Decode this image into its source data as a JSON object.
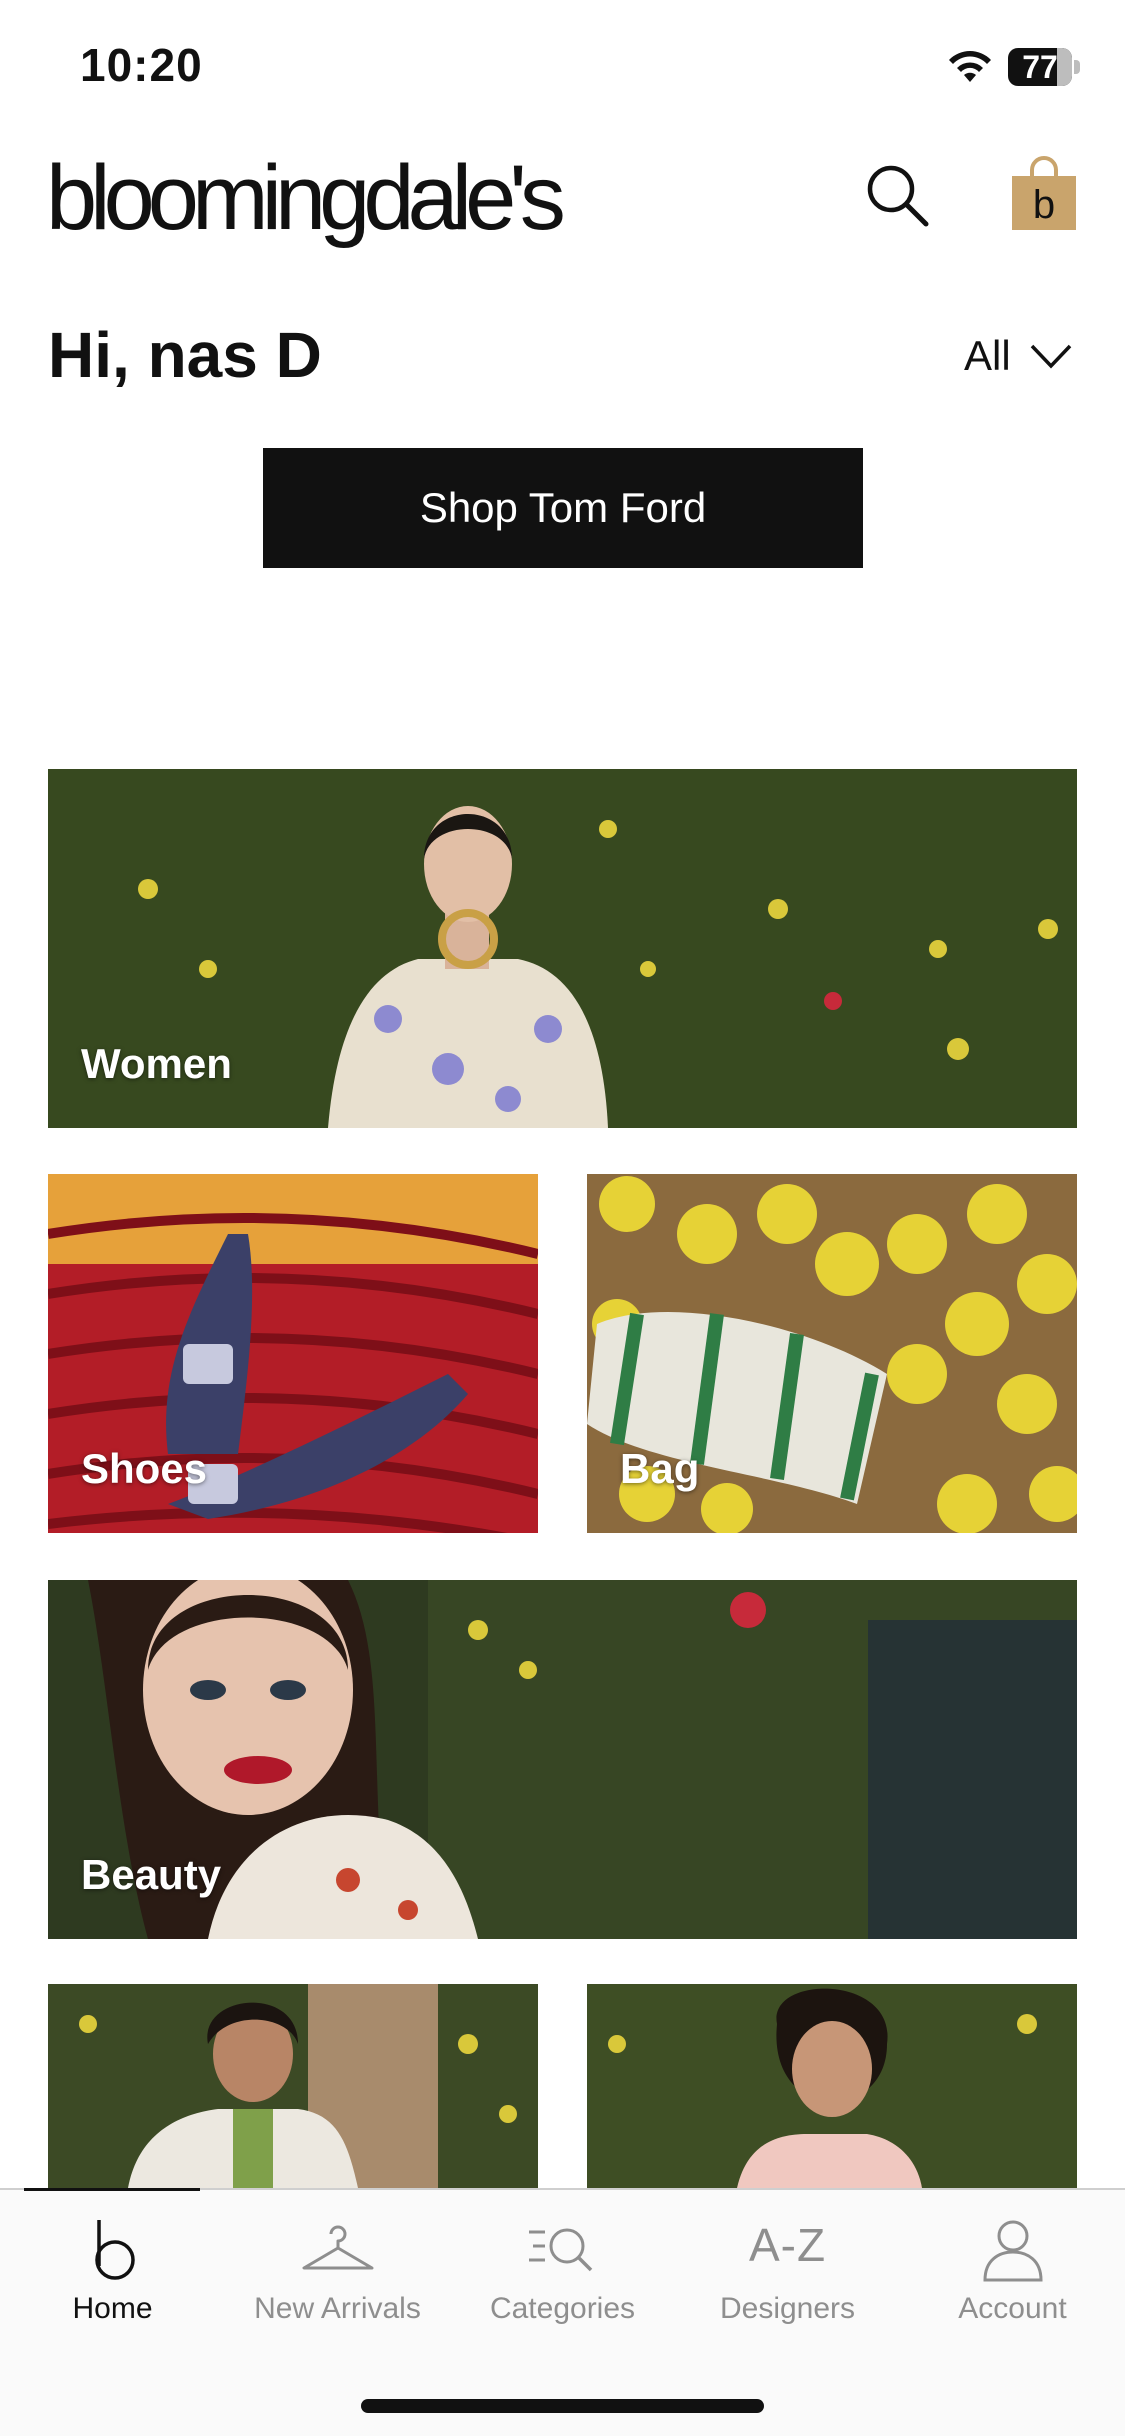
{
  "status_bar": {
    "time": "10:20",
    "battery_percent": "77"
  },
  "header": {
    "logo_text": "bloomingdale's",
    "bag_letter": "b"
  },
  "greeting": "Hi, nas D",
  "filter": {
    "label": "All"
  },
  "cta": {
    "label": "Shop Tom Ford"
  },
  "tiles": [
    {
      "label": "Women"
    },
    {
      "label": "Shoes"
    },
    {
      "label": "Bag"
    },
    {
      "label": "Beauty"
    },
    {
      "label": ""
    },
    {
      "label": ""
    }
  ],
  "tabbar": {
    "items": [
      {
        "label": "Home",
        "icon": "home-b-icon",
        "active": true
      },
      {
        "label": "New Arrivals",
        "icon": "hanger-icon",
        "active": false
      },
      {
        "label": "Categories",
        "icon": "categories-search-icon",
        "active": false
      },
      {
        "label": "Designers",
        "icon": "a-z-text-icon",
        "glyph": "A-Z",
        "active": false
      },
      {
        "label": "Account",
        "icon": "person-icon",
        "active": false
      }
    ]
  },
  "colors": {
    "brand_bag": "#c9a46c",
    "cta_background": "#111111",
    "tab_inactive": "#8e8e8e"
  }
}
